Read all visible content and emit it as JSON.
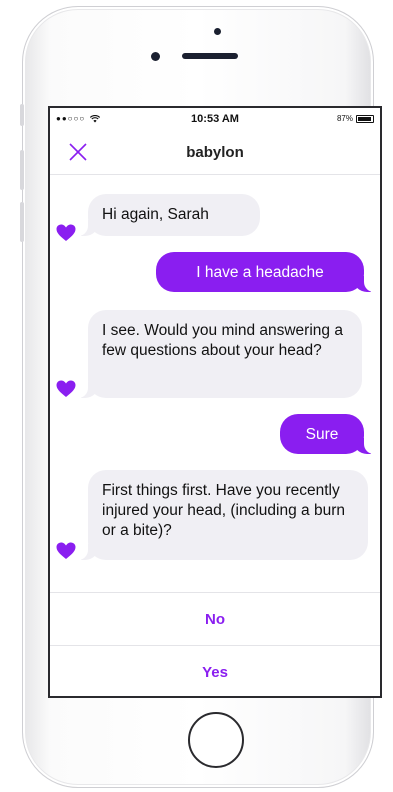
{
  "status_bar": {
    "signal": "●●○○○",
    "time": "10:53 AM",
    "battery": "87%"
  },
  "nav": {
    "title": "babylon",
    "close_icon": "close-icon"
  },
  "messages": [
    {
      "sender": "bot",
      "text": "Hi again, Sarah"
    },
    {
      "sender": "user",
      "text": "I have a headache"
    },
    {
      "sender": "bot",
      "text": "I see. Would you mind answering a few questions about your head?"
    },
    {
      "sender": "user",
      "text": "Sure"
    },
    {
      "sender": "bot",
      "text": "First things first. Have you recently injured your head, (including a burn or a bite)?"
    }
  ],
  "options": [
    {
      "label": "No"
    },
    {
      "label": "Yes"
    }
  ],
  "colors": {
    "accent": "#8a1ef0",
    "bot_bubble": "#f0eff4"
  },
  "icons": {
    "avatar": "heart-icon",
    "close": "close-icon",
    "wifi": "wifi-icon"
  }
}
